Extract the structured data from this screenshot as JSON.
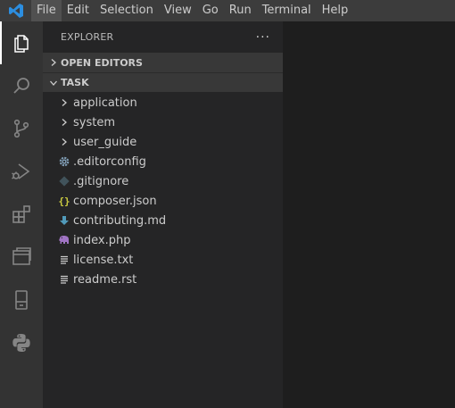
{
  "menubar": {
    "items": [
      "File",
      "Edit",
      "Selection",
      "View",
      "Go",
      "Run",
      "Terminal",
      "Help"
    ]
  },
  "activitybar": {
    "icons": [
      "explorer-icon",
      "search-icon",
      "source-control-icon",
      "run-debug-icon",
      "extensions-icon",
      "remote-explorer-icon",
      "device-icon",
      "python-icon"
    ]
  },
  "sidebar": {
    "title": "EXPLORER",
    "more_label": "···",
    "open_editors": "OPEN EDITORS",
    "folder": "TASK",
    "items": [
      {
        "label": "application",
        "kind": "folder"
      },
      {
        "label": "system",
        "kind": "folder"
      },
      {
        "label": "user_guide",
        "kind": "folder"
      },
      {
        "label": ".editorconfig",
        "kind": "gear"
      },
      {
        "label": ".gitignore",
        "kind": "git"
      },
      {
        "label": "composer.json",
        "kind": "json"
      },
      {
        "label": "contributing.md",
        "kind": "markdown"
      },
      {
        "label": "index.php",
        "kind": "php"
      },
      {
        "label": "license.txt",
        "kind": "text"
      },
      {
        "label": "readme.rst",
        "kind": "text"
      }
    ]
  },
  "colors": {
    "menubar": "#3c3c3c",
    "activitybar": "#333333",
    "sidebar": "#252526",
    "editor": "#1e1e1e",
    "vscode_blue": "#2c8ee0"
  }
}
